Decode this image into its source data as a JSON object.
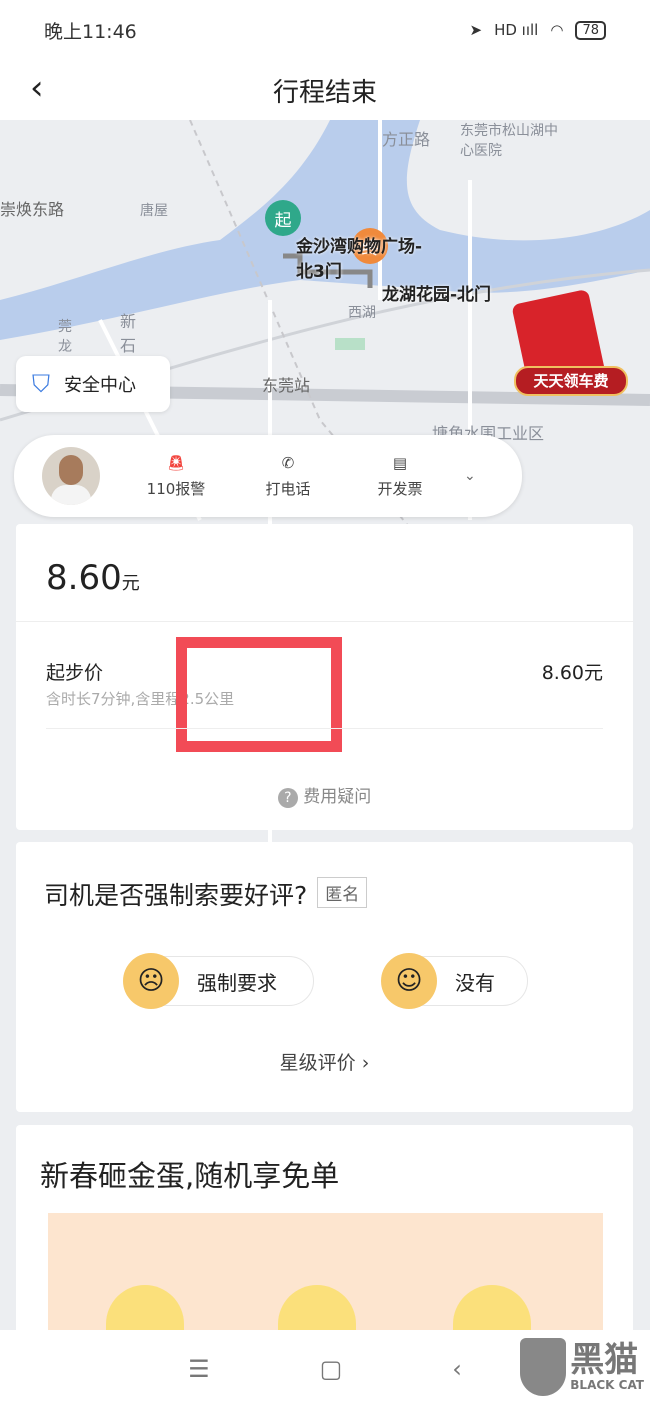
{
  "status_bar": {
    "time": "晚上11:46",
    "signal": "HD ııll",
    "battery": "78"
  },
  "header": {
    "title": "行程结束",
    "back_icon": "chevron-left-icon"
  },
  "map": {
    "start_marker": "起",
    "end_marker": "终",
    "start_label": "金沙湾购物广场-北3门",
    "end_label": "龙湖花园-北门",
    "labels": [
      "方正路",
      "东莞市松山湖中心医院",
      "崇焕东路",
      "唐屋",
      "西湖",
      "新石",
      "东莞站",
      "塘角水围工业区",
      "莞龙"
    ],
    "promo_badge": "天天领车费",
    "colors": {
      "start": "#2fa88a",
      "end": "#f08a3c",
      "water": "#b9cdec"
    }
  },
  "safety_center": {
    "label": "安全中心"
  },
  "driver_actions": [
    {
      "label": "110报警",
      "icon": "alarm-icon"
    },
    {
      "label": "打电话",
      "icon": "phone-icon"
    },
    {
      "label": "开发票",
      "icon": "invoice-icon"
    }
  ],
  "fare": {
    "amount": "8.60",
    "unit": "元",
    "item_label": "起步价",
    "item_desc": "含时长7分钟,含里程2.5公里",
    "item_amount": "8.60元",
    "faq": "费用疑问"
  },
  "survey": {
    "question": "司机是否强制索要好评?",
    "anon": "匿名",
    "option_yes": "强制要求",
    "option_no": "没有",
    "rating_link": "星级评价 ›"
  },
  "promo": {
    "title": "新春砸金蛋,随机享免单"
  },
  "nav": {
    "menu": "☰",
    "home": "▢",
    "back": "‹"
  },
  "watermark": {
    "cn": "黑猫",
    "en": "BLACK CAT"
  }
}
